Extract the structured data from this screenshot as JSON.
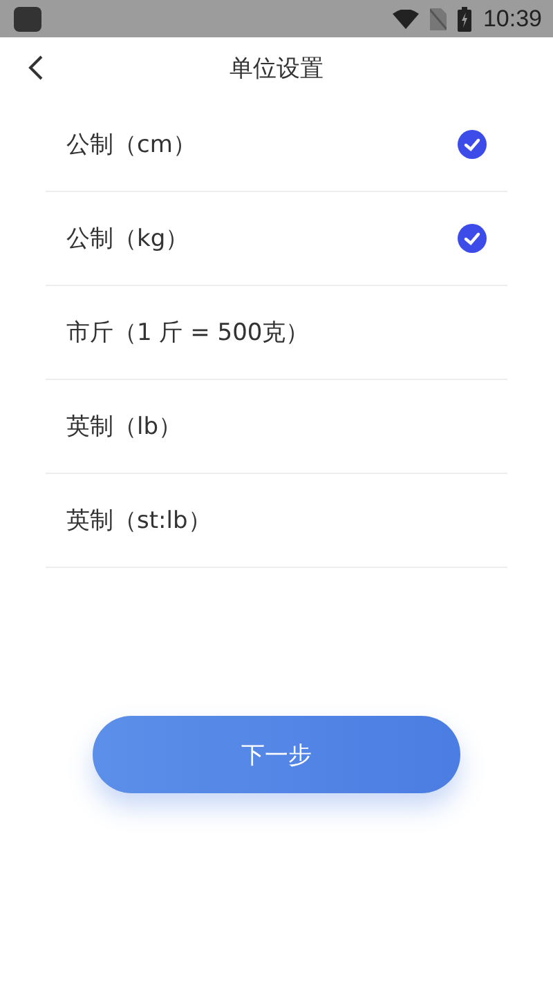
{
  "status_bar": {
    "time": "10:39"
  },
  "header": {
    "title": "单位设置"
  },
  "units": [
    {
      "label": "公制（cm）",
      "selected": true
    },
    {
      "label": "公制（kg）",
      "selected": true
    },
    {
      "label": "市斤（1 斤 = 500克）",
      "selected": false
    },
    {
      "label": "英制（lb）",
      "selected": false
    },
    {
      "label": "英制（st:lb）",
      "selected": false
    }
  ],
  "next_button": {
    "label": "下一步"
  }
}
